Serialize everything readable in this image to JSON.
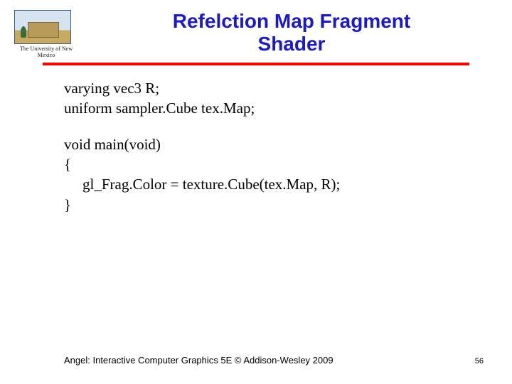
{
  "header": {
    "logo_caption": "The University of New Mexico",
    "title_line1": "Refelction Map Fragment",
    "title_line2": "Shader"
  },
  "code": {
    "decl1": "varying vec3 R;",
    "decl2": "uniform sampler.Cube tex.Map;",
    "main_sig": "void main(void)",
    "brace_open": "{",
    "body1": "gl_Frag.Color = texture.Cube(tex.Map, R);",
    "brace_close": "}"
  },
  "footer": {
    "citation": "Angel: Interactive Computer Graphics 5E © Addison-Wesley 2009",
    "page": "56"
  }
}
